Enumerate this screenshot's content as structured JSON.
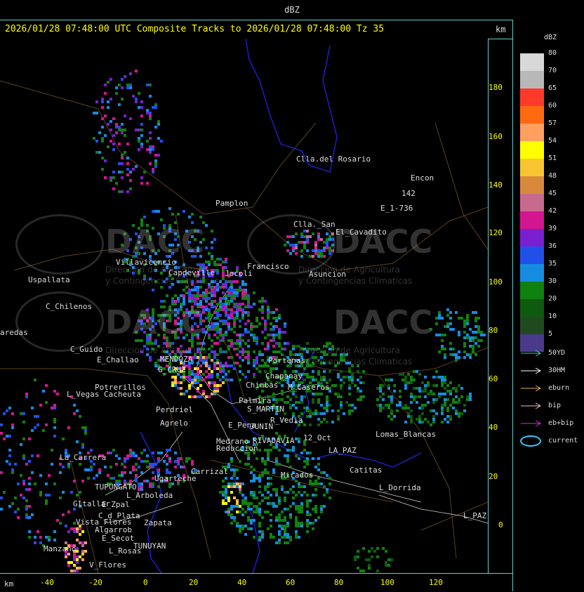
{
  "window_title": "dBZ",
  "header": {
    "text": "2026/01/28 07:48:00 UTC Composite Tracks to 2026/01/28 07:48:00 Tz 35",
    "unit": "km"
  },
  "y_axis": {
    "unit": "km",
    "ticks": [
      "180",
      "160",
      "140",
      "120",
      "100",
      "80",
      "60",
      "40",
      "20",
      "0"
    ]
  },
  "x_axis": {
    "unit": "km",
    "ticks": [
      "-40",
      "-20",
      "0",
      "20",
      "40",
      "60",
      "80",
      "100",
      "120"
    ]
  },
  "legend": {
    "title": "dBZ",
    "levels": [
      {
        "label": "80",
        "color": "#d8d8d8"
      },
      {
        "label": "70",
        "color": "#b8b8b8"
      },
      {
        "label": "65",
        "color": "#ff3a2a"
      },
      {
        "label": "60",
        "color": "#ff6a10"
      },
      {
        "label": "57",
        "color": "#ff9f60"
      },
      {
        "label": "54",
        "color": "#ffff00"
      },
      {
        "label": "51",
        "color": "#f7c531"
      },
      {
        "label": "48",
        "color": "#d8893c"
      },
      {
        "label": "45",
        "color": "#c86a8e"
      },
      {
        "label": "42",
        "color": "#d2168f"
      },
      {
        "label": "39",
        "color": "#7a1fd0"
      },
      {
        "label": "36",
        "color": "#2050e8"
      },
      {
        "label": "35",
        "color": "#158ce0"
      },
      {
        "label": "30",
        "color": "#108010"
      },
      {
        "label": "20",
        "color": "#0e5a0e"
      },
      {
        "label": "10",
        "color": "#1f4a1f"
      },
      {
        "label": "5",
        "color": "#4a3a8a"
      }
    ],
    "tracks": [
      {
        "label": "50YD",
        "color": "#33cccc"
      },
      {
        "label": "30HM",
        "color": "#ffffff"
      },
      {
        "label": "eburn",
        "color": "#e8b070"
      },
      {
        "label": "bip",
        "color": "#f0c0c0"
      },
      {
        "label": "eb+bip",
        "color": "#cc33cc"
      }
    ],
    "current_label": "current"
  },
  "watermark": {
    "brand": "DACC",
    "line1": "Direccion de Agricultura",
    "line2": "y Contingencias Climaticas"
  },
  "places": [
    {
      "name": "Clla.del Rosario"
    },
    {
      "name": "Encon"
    },
    {
      "name": "142"
    },
    {
      "name": "E_1-736"
    },
    {
      "name": "Pamplon"
    },
    {
      "name": "Clla._San"
    },
    {
      "name": "El_Cavadito"
    },
    {
      "name": "Villavicencio"
    },
    {
      "name": "Uspallata"
    },
    {
      "name": "Capdeville"
    },
    {
      "name": "Francisco"
    },
    {
      "name": "Asuncion"
    },
    {
      "name": "Jocoli"
    },
    {
      "name": "C_Chilenos"
    },
    {
      "name": "aredas"
    },
    {
      "name": "C_Guido"
    },
    {
      "name": "E_Challao"
    },
    {
      "name": "MENDOZA"
    },
    {
      "name": "G_CRUZ"
    },
    {
      "name": "Portenas"
    },
    {
      "name": "Chimbas"
    },
    {
      "name": "Chapanay"
    },
    {
      "name": "M_Caseros"
    },
    {
      "name": "Potrerillos"
    },
    {
      "name": "L_Vegas"
    },
    {
      "name": "Cacheuta"
    },
    {
      "name": "Perdriel"
    },
    {
      "name": "Agrelo"
    },
    {
      "name": "Palmira"
    },
    {
      "name": "S_MARTIN"
    },
    {
      "name": "R_Vedia"
    },
    {
      "name": "E_Pena"
    },
    {
      "name": "JUNIN"
    },
    {
      "name": "Medrano"
    },
    {
      "name": "Reduccion"
    },
    {
      "name": "RIVADAVIA"
    },
    {
      "name": "12_Oct"
    },
    {
      "name": "LA_PAZ"
    },
    {
      "name": "Lomas_Blancas"
    },
    {
      "name": "La_Carrera"
    },
    {
      "name": "Carrizal"
    },
    {
      "name": "Ugarteche"
    },
    {
      "name": "Mirados"
    },
    {
      "name": "Catitas"
    },
    {
      "name": "L_Dorrida"
    },
    {
      "name": "TUPUNGATO"
    },
    {
      "name": "E_Zpal"
    },
    {
      "name": "L_Arboleda"
    },
    {
      "name": "Gltallar"
    },
    {
      "name": "C_d_Plata"
    },
    {
      "name": "Zapata"
    },
    {
      "name": "L_Rosas"
    },
    {
      "name": "TUNUYAN"
    },
    {
      "name": "Manzano"
    },
    {
      "name": "V_Flores"
    },
    {
      "name": "Vista_Flores"
    },
    {
      "name": "Algarrob"
    },
    {
      "name": "E_Secot"
    },
    {
      "name": "L_PAZ"
    }
  ]
}
